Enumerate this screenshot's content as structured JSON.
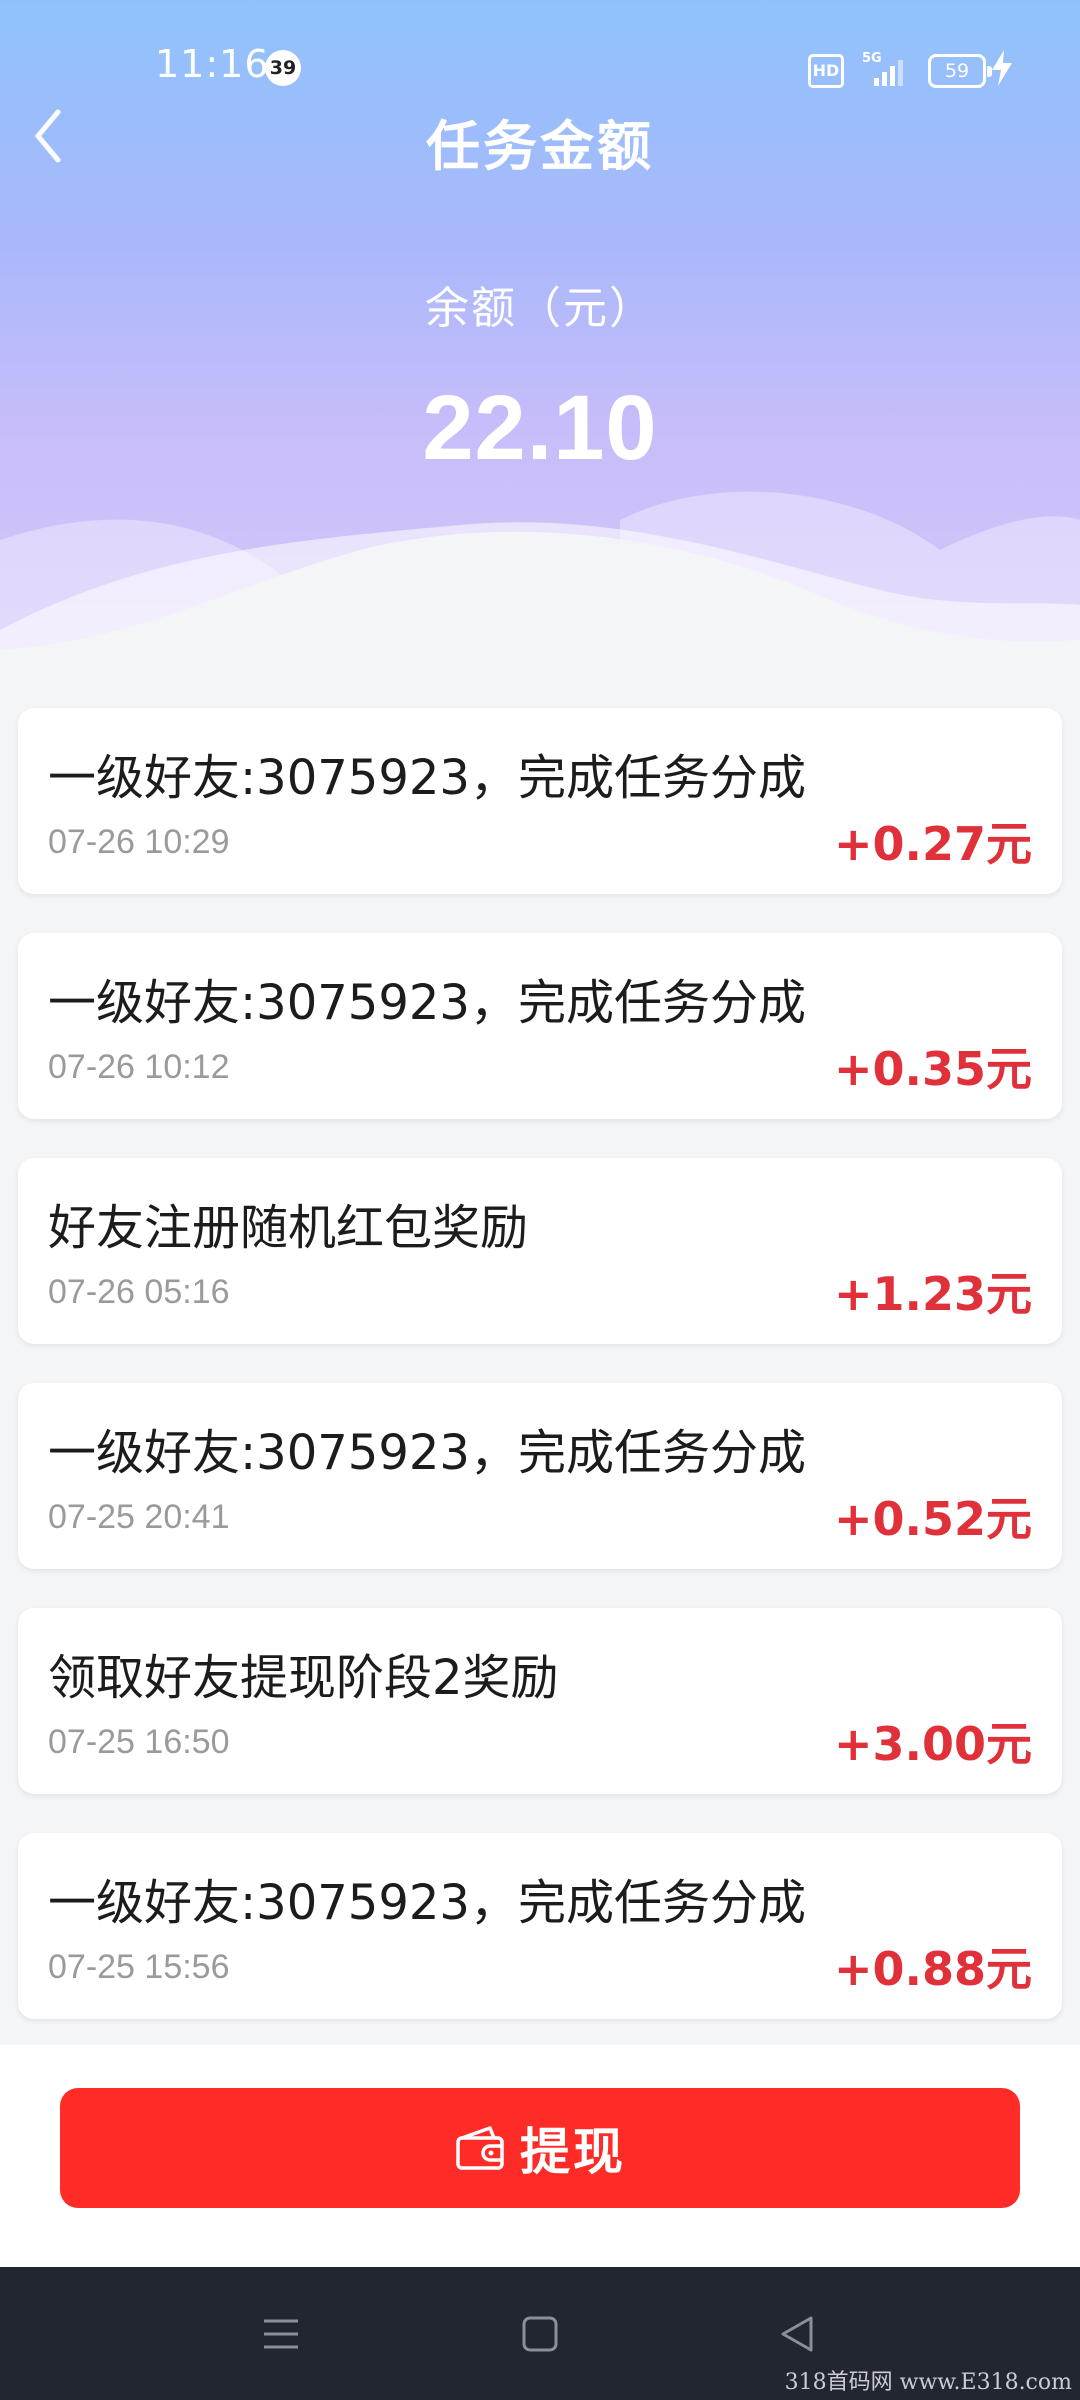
{
  "status_bar": {
    "time": "11:16",
    "notification_count": "39",
    "hd_label": "HD",
    "network_label": "5G",
    "battery_level": "59"
  },
  "header": {
    "title": "任务金额",
    "balance_label": "余额（元）",
    "balance_value": "22.10"
  },
  "records": [
    {
      "title": "一级好友:3075923，完成任务分成",
      "time": "07-26 10:29",
      "amount": "+0.27元"
    },
    {
      "title": "一级好友:3075923，完成任务分成",
      "time": "07-26 10:12",
      "amount": "+0.35元"
    },
    {
      "title": "好友注册随机红包奖励",
      "time": "07-26 05:16",
      "amount": "+1.23元"
    },
    {
      "title": "一级好友:3075923，完成任务分成",
      "time": "07-25 20:41",
      "amount": "+0.52元"
    },
    {
      "title": "领取好友提现阶段2奖励",
      "time": "07-25 16:50",
      "amount": "+3.00元"
    },
    {
      "title": "一级好友:3075923，完成任务分成",
      "time": "07-25 15:56",
      "amount": "+0.88元"
    }
  ],
  "actions": {
    "withdraw_label": "提现"
  },
  "watermark": "318首码网 www.E318.com",
  "colors": {
    "accent_red": "#fe2b26",
    "amount_red": "#e0313a",
    "header_top": "#8fc2fb",
    "header_bottom": "#d9c8f9",
    "nav_bar": "#21262f"
  },
  "icons": {
    "back": "chevron-left-icon",
    "withdraw": "wallet-icon",
    "nav_menu": "menu-icon",
    "nav_home": "home-square-icon",
    "nav_back": "triangle-back-icon"
  }
}
